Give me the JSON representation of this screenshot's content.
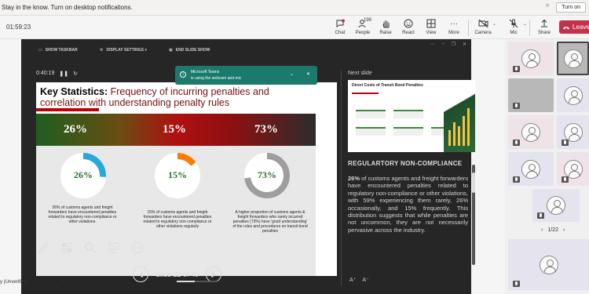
{
  "notification": {
    "text": "Stay in the know. Turn on desktop notifications.",
    "button": "Turn on"
  },
  "meeting": {
    "timer": "01:59:23"
  },
  "toolbar": {
    "chat": "Chat",
    "people": "People",
    "people_count": "199",
    "raise": "Raise",
    "react": "React",
    "view": "View",
    "more": "More",
    "camera": "Camera",
    "mic": "Mic",
    "share": "Share",
    "leave": "Leave"
  },
  "presenter": {
    "top_bar": {
      "show_taskbar": "SHOW TASKBAR",
      "display_settings": "DISPLAY SETTINGS ▾",
      "end_show": "END SLIDE SHOW"
    },
    "slide_timer": "0:40:19",
    "slide": {
      "title_bold": "Key Statistics:",
      "title_rest": " Frequency of incurring penalties and correlation with understanding penalty rules",
      "band_values": [
        "26%",
        "15%",
        "73%"
      ],
      "rings": [
        {
          "label": "26%",
          "fraction": 0.26,
          "color": "#29a8e0"
        },
        {
          "label": "15%",
          "fraction": 0.15,
          "color": "#ff7a00"
        },
        {
          "label": "73%",
          "fraction": 0.73,
          "color": "#9e9e9e"
        }
      ],
      "descriptions": [
        "26% of customs agents and freight forwarders have encountered penalties related to regulatory non-compliance or other violations.",
        "15% of customs agents and freight forwarders have encountered penalties related to regulatory non-compliance or other violations regularly",
        "A higher proportion of customs agents & freight forwarders who rarely incurred penalties (73%) have 'good understanding' of the rules and procedures on transit bond penalties"
      ]
    },
    "navigation": {
      "label": "Slide 22 of 49",
      "progress": 0.45
    },
    "next_slide": {
      "label": "Next slide",
      "title": "Direct Costs of Transit Bond Penalties"
    },
    "notes": {
      "heading": "REGULARTORY NON-COMPLIANCE",
      "lead": "26%",
      "body": " of customs agents and freight forwarders have encountered penalties related to regulatory non-compliance or other violations, with 59% experiencing them rarely, 26% occasionally, and 15% frequently. This distribution suggests that while penalties are not uncommon, they are not necessarily pervasive across the industry."
    },
    "font_buttons": [
      "A⁺",
      "A⁻"
    ]
  },
  "toast": {
    "title": "Microsoft Teams",
    "message": "is using the webcam and mic"
  },
  "zoom": {
    "label": "y (Unverified)",
    "minus": "—",
    "plus": "+"
  },
  "gallery": {
    "pager": "1/22",
    "prev": "‹",
    "next": "›"
  }
}
